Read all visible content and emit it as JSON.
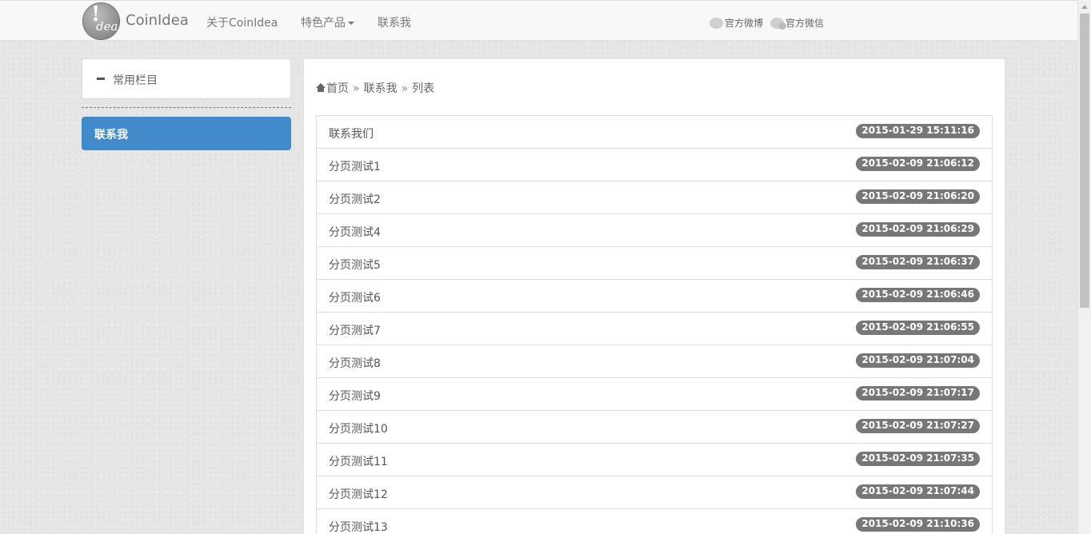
{
  "header": {
    "logo_text": "!dea",
    "brand": "CoinIdea",
    "nav": {
      "about": "关于CoinIdea",
      "products": "特色产品",
      "contact": "联系我"
    },
    "social": {
      "weibo": "官方微博",
      "wechat": "官方微信"
    }
  },
  "sidebar": {
    "panel_title": "常用栏目",
    "active_item": "联系我"
  },
  "breadcrumb": {
    "home": "首页",
    "section": "联系我",
    "current": "列表",
    "separator": "»"
  },
  "list": {
    "items": [
      {
        "title": "联系我们",
        "time": "2015-01-29 15:11:16"
      },
      {
        "title": "分页测试1",
        "time": "2015-02-09 21:06:12"
      },
      {
        "title": "分页测试2",
        "time": "2015-02-09 21:06:20"
      },
      {
        "title": "分页测试4",
        "time": "2015-02-09 21:06:29"
      },
      {
        "title": "分页测试5",
        "time": "2015-02-09 21:06:37"
      },
      {
        "title": "分页测试6",
        "time": "2015-02-09 21:06:46"
      },
      {
        "title": "分页测试7",
        "time": "2015-02-09 21:06:55"
      },
      {
        "title": "分页测试8",
        "time": "2015-02-09 21:07:04"
      },
      {
        "title": "分页测试9",
        "time": "2015-02-09 21:07:17"
      },
      {
        "title": "分页测试10",
        "time": "2015-02-09 21:07:27"
      },
      {
        "title": "分页测试11",
        "time": "2015-02-09 21:07:35"
      },
      {
        "title": "分页测试12",
        "time": "2015-02-09 21:07:44"
      },
      {
        "title": "分页测试13",
        "time": "2015-02-09 21:10:36"
      }
    ]
  },
  "colors": {
    "active_blue": "#428bca",
    "badge_gray": "#777777"
  }
}
